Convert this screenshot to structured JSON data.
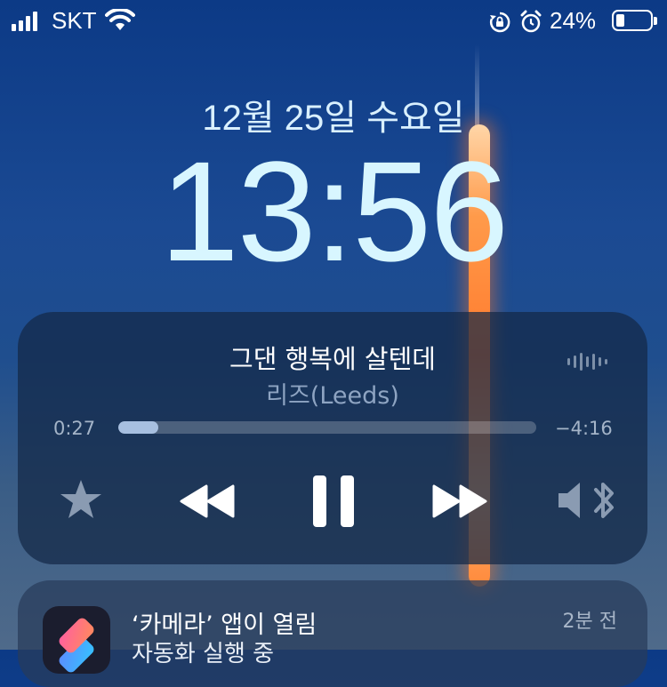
{
  "status_bar": {
    "carrier": "SKT",
    "battery_percent": "24%",
    "battery_level": 0.24
  },
  "lock_screen": {
    "date": "12월 25일 수요일",
    "time": "13:56"
  },
  "now_playing": {
    "title": "그댄 행복에 살텐데",
    "artist": "리즈(Leeds)",
    "elapsed": "0:27",
    "remaining": "−4:16",
    "progress": 0.095,
    "controls": [
      "star-icon",
      "rewind-icon",
      "pause-icon",
      "fast-forward-icon",
      "speaker-bluetooth-icon"
    ]
  },
  "notification": {
    "app_icon": "shortcuts-icon",
    "title": "‘카메라’ 앱이 열림",
    "body": "자동화 실행 중",
    "time": "2분 전"
  }
}
